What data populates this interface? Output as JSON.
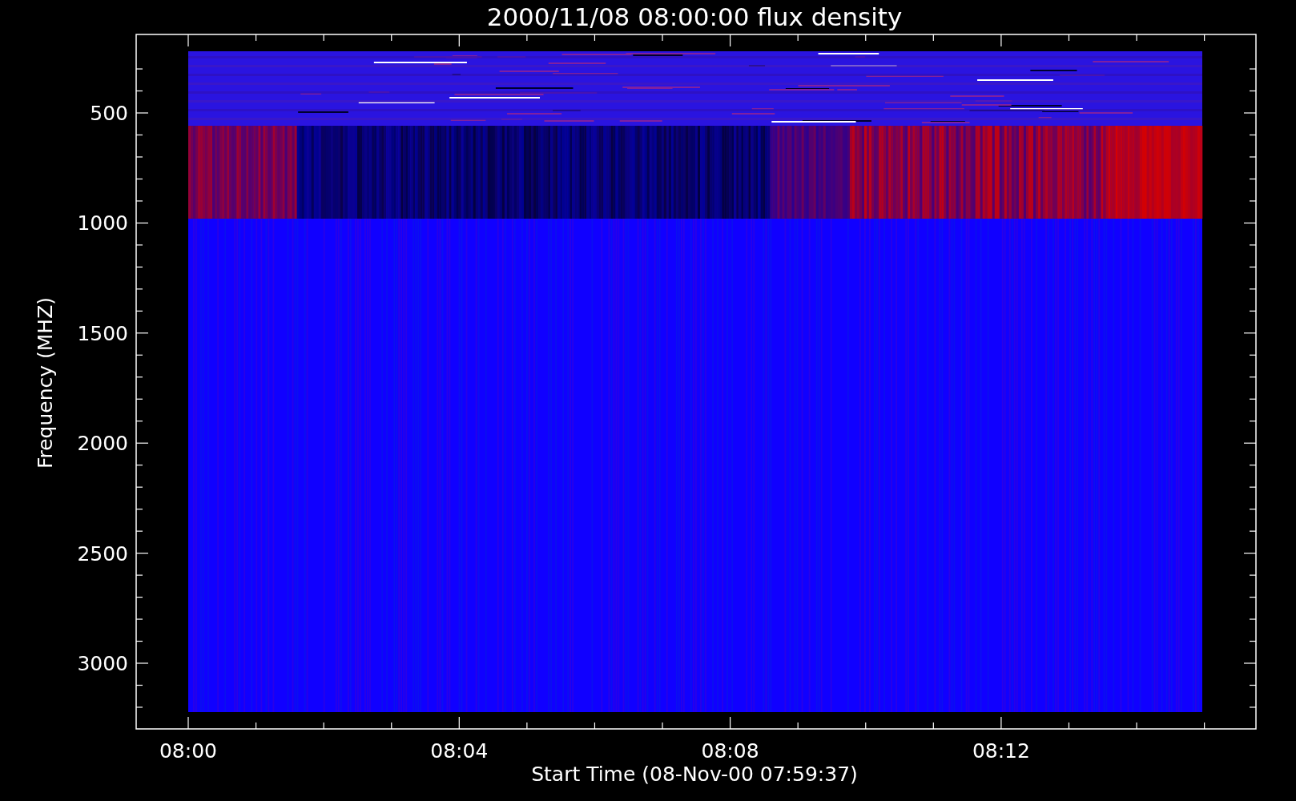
{
  "title": "2000/11/08 08:00:00 flux density",
  "y_axis": {
    "label": "Frequency (MHZ)",
    "tick_labels": [
      "500",
      "1000",
      "1500",
      "2000",
      "2500",
      "3000"
    ]
  },
  "x_axis": {
    "label": "Start Time (08-Nov-00 07:59:37)",
    "tick_labels": [
      "08:00",
      "08:04",
      "08:08",
      "08:12"
    ]
  }
}
